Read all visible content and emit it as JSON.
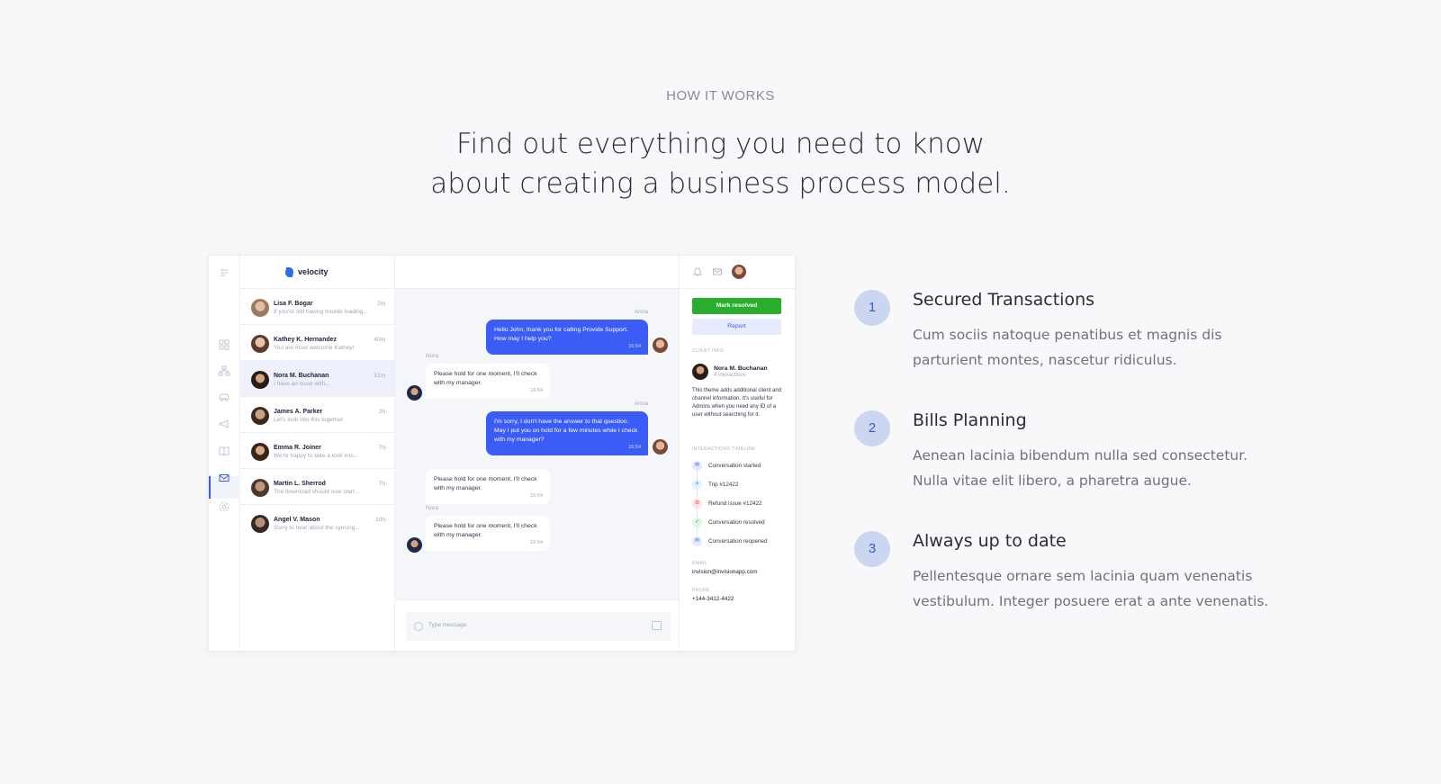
{
  "section": {
    "eyebrow": "HOW IT WORKS",
    "headline_line1": "Find out everything you need to know",
    "headline_line2": "about creating a business process model."
  },
  "app": {
    "brand": "velocity",
    "conversations": [
      {
        "name": "Lisa F. Bogar",
        "preview": "If you're still having trouble loading...",
        "time": "2m"
      },
      {
        "name": "Kathey K. Hernandez",
        "preview": "You are most welcome Kathey!",
        "time": "40m"
      },
      {
        "name": "Nora M. Buchanan",
        "preview": "I have an issue with...",
        "time": "51m"
      },
      {
        "name": "James A. Parker",
        "preview": "Let's look into this together",
        "time": "2h"
      },
      {
        "name": "Emma R. Joiner",
        "preview": "We're happy to take a look into...",
        "time": "7h"
      },
      {
        "name": "Martin L. Sherrod",
        "preview": "The download should now start...",
        "time": "7h"
      },
      {
        "name": "Angel V. Mason",
        "preview": "Sorry to hear about the syncing...",
        "time": "10h"
      }
    ],
    "messages": [
      {
        "author": "Anna",
        "text": "Hello John, thank you for calling Provide Support. How may I help you?",
        "time": "16:54"
      },
      {
        "author": "Nora",
        "text": "Please hold for one moment, I'll check with my manager.",
        "time": "16:54"
      },
      {
        "author": "Anna",
        "text": "I'm sorry, I don't have the answer to that question. May I put you on hold for a few minutes while I check with my manager?",
        "time": "16:54"
      },
      {
        "author": "",
        "text": "Please hold for one moment, I'll check with my manager.",
        "time": "16:54"
      },
      {
        "author": "Nora",
        "text": "Please hold for one moment, I'll check with my manager.",
        "time": "16:54"
      }
    ],
    "composer_placeholder": "Type message",
    "info": {
      "mark_resolved": "Mark resolved",
      "report": "Report",
      "client_info_label": "CLIENT INFO",
      "client_name": "Nora M. Buchanan",
      "client_interactions": "4 interactions",
      "client_desc": "This theme adds additional client and channel information. It's useful for Admins when you need any ID of a user without searching for it.",
      "timeline_label": "INTERACTIONS TIMELINE",
      "timeline": [
        {
          "text": "Conversation started",
          "icon": "mail-icon"
        },
        {
          "text": "Trip #12422",
          "icon": "plane-icon"
        },
        {
          "text": "Refund issue #12422",
          "icon": "ban-icon"
        },
        {
          "text": "Conversation resolved",
          "icon": "check-icon"
        },
        {
          "text": "Conversation reopened",
          "icon": "mail-icon"
        }
      ],
      "email_label": "EMAIL",
      "email": "invision@invisionapp.com",
      "phone_label": "PHONE",
      "phone": "+144-3412-4422"
    }
  },
  "steps": [
    {
      "num": "1",
      "title": "Secured Transactions",
      "desc": "Cum sociis natoque penatibus et magnis dis parturient montes, nascetur ridiculus."
    },
    {
      "num": "2",
      "title": "Bills Planning",
      "desc": "Aenean lacinia bibendum nulla sed consectetur. Nulla vitae elit libero, a pharetra augue."
    },
    {
      "num": "3",
      "title": "Always up to date",
      "desc": "Pellentesque ornare sem lacinia quam venenatis vestibulum. Integer posuere erat a ante venenatis."
    }
  ],
  "colors": {
    "accent": "#3b5cf5",
    "resolved_green": "#2aae2e",
    "step_circle": "#cbd6f1"
  }
}
